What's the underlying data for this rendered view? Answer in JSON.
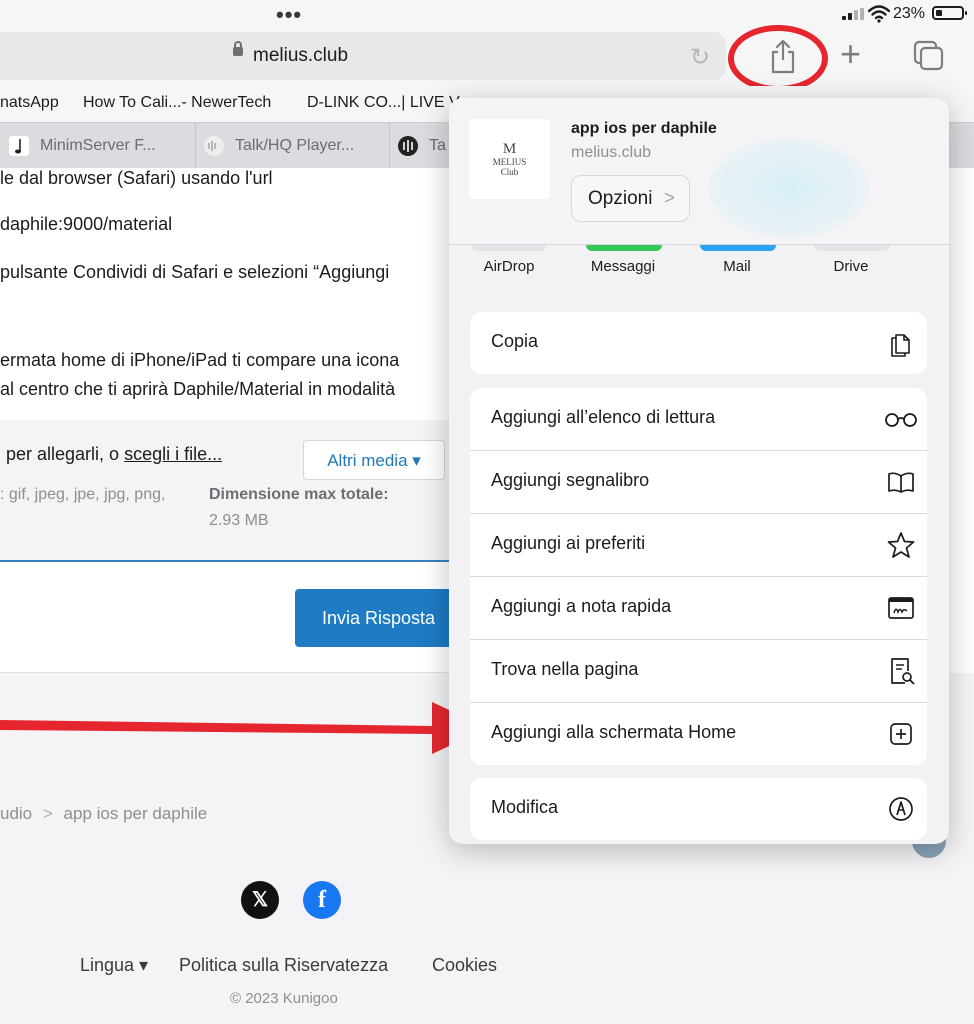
{
  "status_bar": {
    "battery_percent": "23%",
    "battery_level": 0.23
  },
  "toolbar": {
    "url": "melius.club"
  },
  "bookmarks": [
    "natsApp",
    "How To Cali...- NewerTech",
    "D-LINK CO...| LIVE V"
  ],
  "tabs": [
    {
      "label": "MinimServer F...",
      "icon": "music-note-icon"
    },
    {
      "label": "Talk/HQ Player...",
      "icon": "audio-icon"
    },
    {
      "label": "Ta",
      "icon": "audio-icon"
    }
  ],
  "page": {
    "lines": [
      "le dal browser (Safari) usando l'url",
      "daphile:9000/material",
      "pulsante Condividi di Safari e selezioni “Aggiungi",
      "ermata home di iPhone/iPad ti compare una icona",
      "al centro che ti aprirà Daphile/Material in modalità"
    ],
    "attach_text_prefix": "per allegarli, o ",
    "attach_link": "scegli i file...",
    "altri_media": "Altri media ▾",
    "types": ": gif, jpeg, jpe, jpg, png,",
    "max_label": "Dimensione max totale:",
    "max_value": "2.93 MB",
    "send_button": "Invia Risposta",
    "breadcrumb_prev": "udio",
    "breadcrumb_sep": ">",
    "breadcrumb_current": "app ios per daphile",
    "footer_links": {
      "language": "Lingua ▾",
      "privacy": "Politica sulla Riservatezza",
      "cookies": "Cookies"
    },
    "copyright": "© 2023 Kunigoo",
    "social": {
      "x": "𝕏",
      "facebook": "f"
    }
  },
  "share_sheet": {
    "title": "app ios per daphile",
    "subtitle": "melius.club",
    "thumb_logo": "M",
    "thumb_text": "MELIUS\nClub",
    "options_button": "Opzioni",
    "options_chevron": ">",
    "apps": [
      {
        "label": "AirDrop",
        "color": "#f2f2f5"
      },
      {
        "label": "Messaggi",
        "color": "#34c759"
      },
      {
        "label": "Mail",
        "color": "#2aa3f4"
      },
      {
        "label": "Drive",
        "color": "#f2f2f5"
      }
    ],
    "copy_group": [
      {
        "label": "Copia",
        "icon": "copy-icon"
      }
    ],
    "main_group": [
      {
        "label": "Aggiungi all’elenco di lettura",
        "icon": "glasses-icon"
      },
      {
        "label": "Aggiungi segnalibro",
        "icon": "book-icon"
      },
      {
        "label": "Aggiungi ai preferiti",
        "icon": "star-icon"
      },
      {
        "label": "Aggiungi a nota rapida",
        "icon": "quick-note-icon"
      },
      {
        "label": "Trova nella pagina",
        "icon": "find-in-page-icon"
      },
      {
        "label": "Aggiungi alla schermata Home",
        "icon": "add-square-icon"
      }
    ],
    "edit_group": [
      {
        "label": "Modifica",
        "icon": "markup-icon"
      }
    ]
  },
  "colors": {
    "accent_blue": "#1e7bc4",
    "highlight_red": "#e5262f",
    "messages_green": "#34c759",
    "mail_blue": "#2aa3f4"
  }
}
